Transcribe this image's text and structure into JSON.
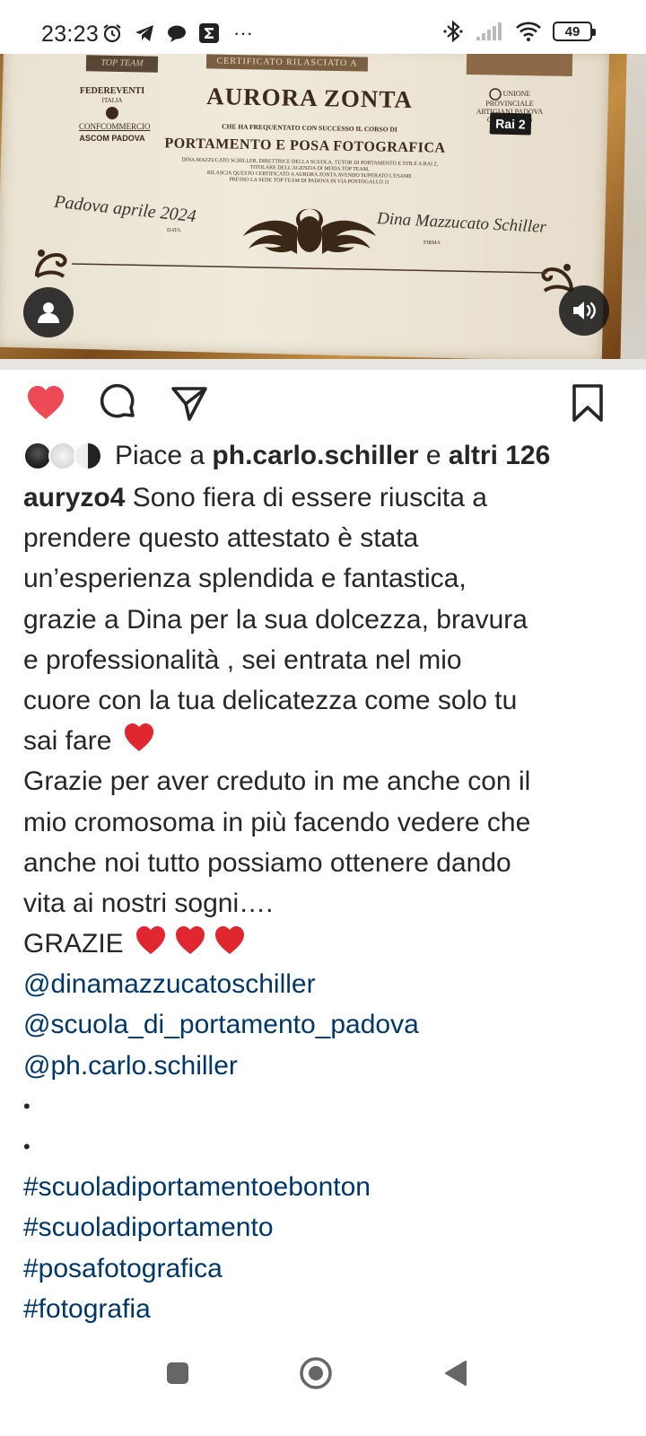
{
  "status_bar": {
    "time": "23:23",
    "more": "···",
    "battery": "49"
  },
  "certificate": {
    "top_badge": "TOP TEAM",
    "header": "CERTIFICATO RILASCIATO A",
    "logo_left": [
      "FEDEREVENTI",
      "ITALIA",
      "CONFCOMMERCIO",
      "ASCOM PADOVA"
    ],
    "logo_right": "UNIONE PROVINCIALE ARTIGIANI PADOVA Confartigianato",
    "rai": "Rai 2",
    "name": "AURORA ZONTA",
    "subtitle": "CHE HA FREQUENTATO CON SUCCESSO IL CORSO DI",
    "course": "PORTAMENTO E POSA FOTOGRAFICA",
    "body": [
      "DINA MAZZUCATO SCHILLER, DIRETTRICE DELLA SCUOLA, TUTOR DI PORTAMENTO E STILE A RAI 2,",
      "TITOLARE DELL'AGENZIA DI MODA TOP TEAM,",
      "RILASCIA QUESTO CERTIFICATO A AURORA ZONTA AVENDO SUPERATO L'ESAME",
      "PRESSO LA SEDE TOP TEAM DI PADOVA IN VIA POSTOGALLO 11"
    ],
    "date_handwritten": "Padova aprile 2024",
    "date_label": "DATA",
    "signature": "Dina Mazzucato Schiller",
    "signature_label": "FIRMA"
  },
  "actions": {
    "like_color": "#ed4956"
  },
  "likes": {
    "prefix": "Piace a",
    "user": "ph.carlo.schiller",
    "connector": "e",
    "others": "altri 126"
  },
  "post": {
    "username": "auryzo4",
    "lines": [
      " Sono fiera di essere riuscita a",
      "prendere questo attestato è stata",
      "un’esperienza splendida e fantastica,",
      "grazie a Dina per la sua dolcezza, bravura",
      "e professionalità , sei entrata nel mio",
      "cuore con la tua delicatezza come solo tu",
      "sai fare",
      "Grazie per aver creduto in me anche con il",
      "mio cromosoma in più facendo vedere che",
      "anche noi tutto possiamo ottenere dando",
      "vita ai nostri sogni….",
      "GRAZIE"
    ],
    "mentions": [
      "@dinamazzucatoschiller",
      "@scuola_di_portamento_padova",
      "@ph.carlo.schiller"
    ],
    "dots": [
      "•",
      "•"
    ],
    "hashtags": [
      "#scuoladiportamentoebonton",
      "#scuoladiportamento",
      "#posafotografica",
      "#fotografia"
    ],
    "heart_color": "#e0262e",
    "link_color": "#00376b"
  }
}
